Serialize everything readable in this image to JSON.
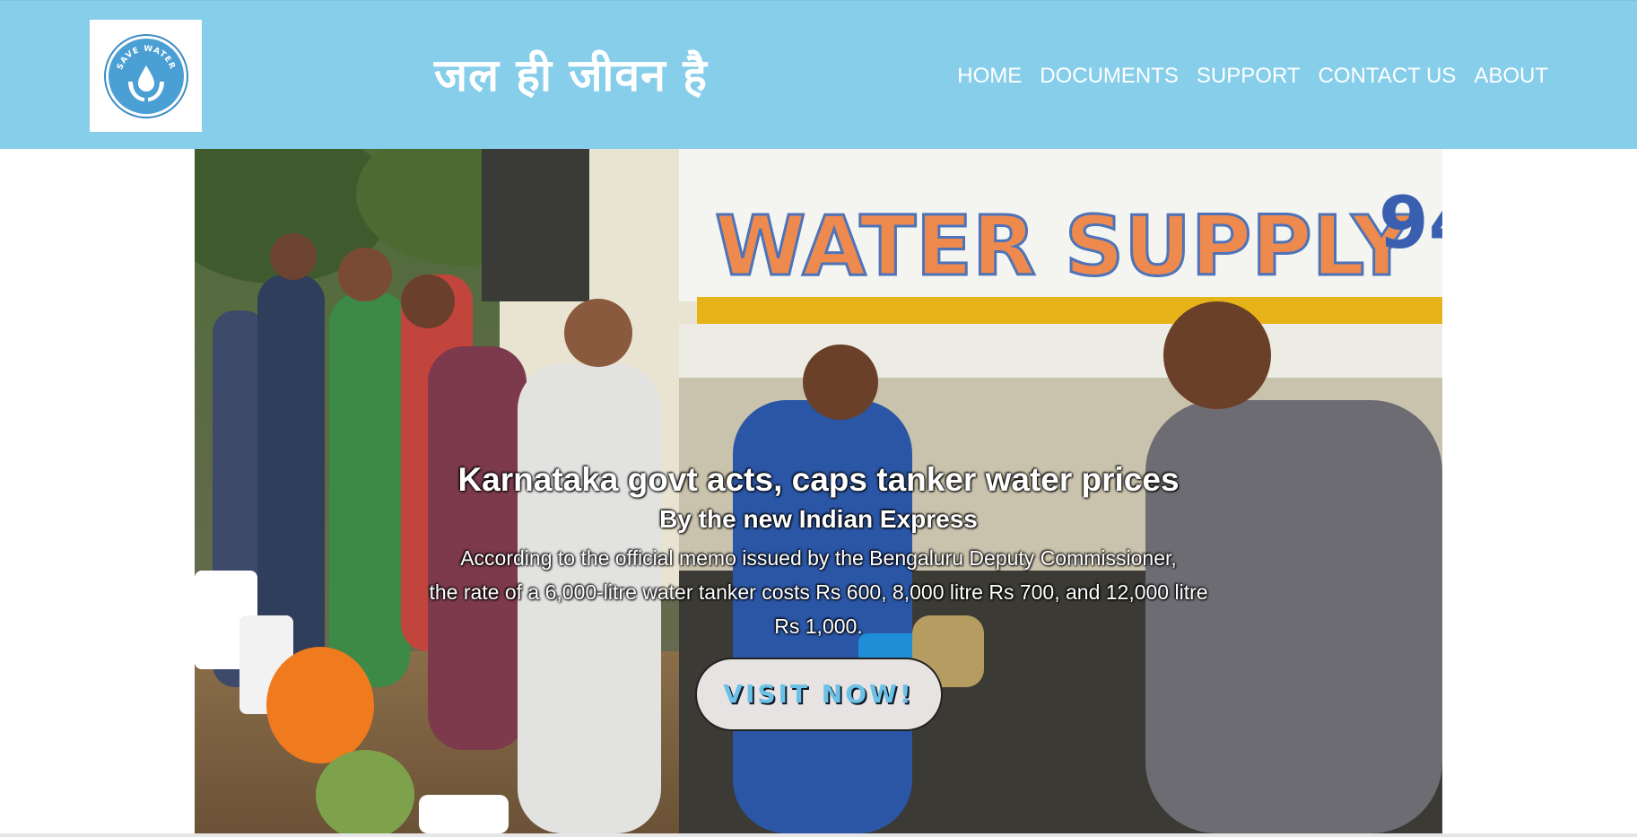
{
  "header": {
    "logo_text": "SAVE WATER",
    "site_title": "जल ही जीवन है",
    "background_color": "#87ceeb"
  },
  "nav": {
    "items": [
      {
        "label": "HOME"
      },
      {
        "label": "DOCUMENTS"
      },
      {
        "label": "SUPPORT"
      },
      {
        "label": "CONTACT US"
      },
      {
        "label": "ABOUT"
      }
    ]
  },
  "hero": {
    "image_text": "WATER SUPPLY",
    "title": "Karnataka govt acts, caps tanker water prices",
    "subtitle": "By the new Indian Express",
    "description_line1": "According to the official memo issued by the Bengaluru Deputy Commissioner,",
    "description_line2": "the rate of a 6,000-litre water tanker costs Rs 600, 8,000 litre Rs 700, and 12,000 litre Rs 1,000.",
    "button_label": "VISIT NOW!"
  }
}
